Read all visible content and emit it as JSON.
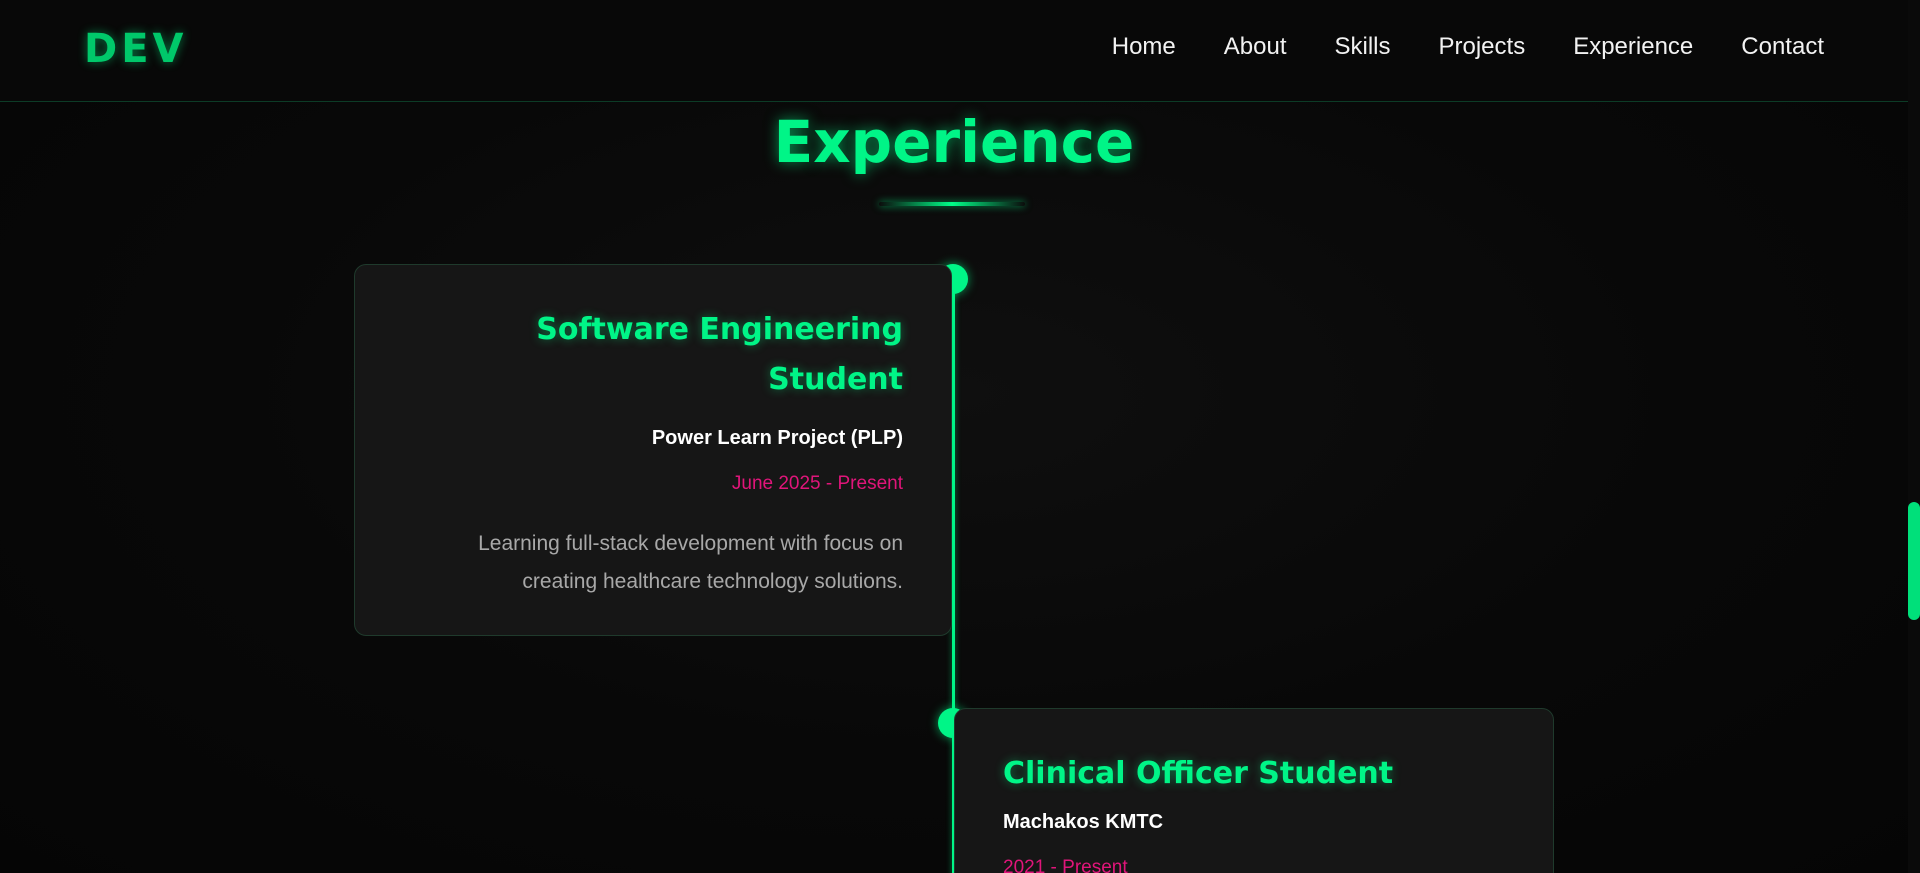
{
  "nav": {
    "logo": "DEV",
    "links": [
      "Home",
      "About",
      "Skills",
      "Projects",
      "Experience",
      "Contact"
    ]
  },
  "section": {
    "title": "Experience"
  },
  "experience": [
    {
      "title_lines": [
        "Software Engineering",
        "Student"
      ],
      "organization": "Power Learn Project (PLP)",
      "date": "June 2025 - Present",
      "description_lines": [
        "Learning full-stack development with focus on",
        "creating healthcare technology solutions."
      ]
    },
    {
      "title_lines": [
        "Clinical Officer Student"
      ],
      "organization": "Machakos KMTC",
      "date": "2021 - Present"
    }
  ],
  "colors": {
    "accent": "#00f587",
    "date": "#e0157a",
    "background": "#070707",
    "card": "#161616"
  }
}
